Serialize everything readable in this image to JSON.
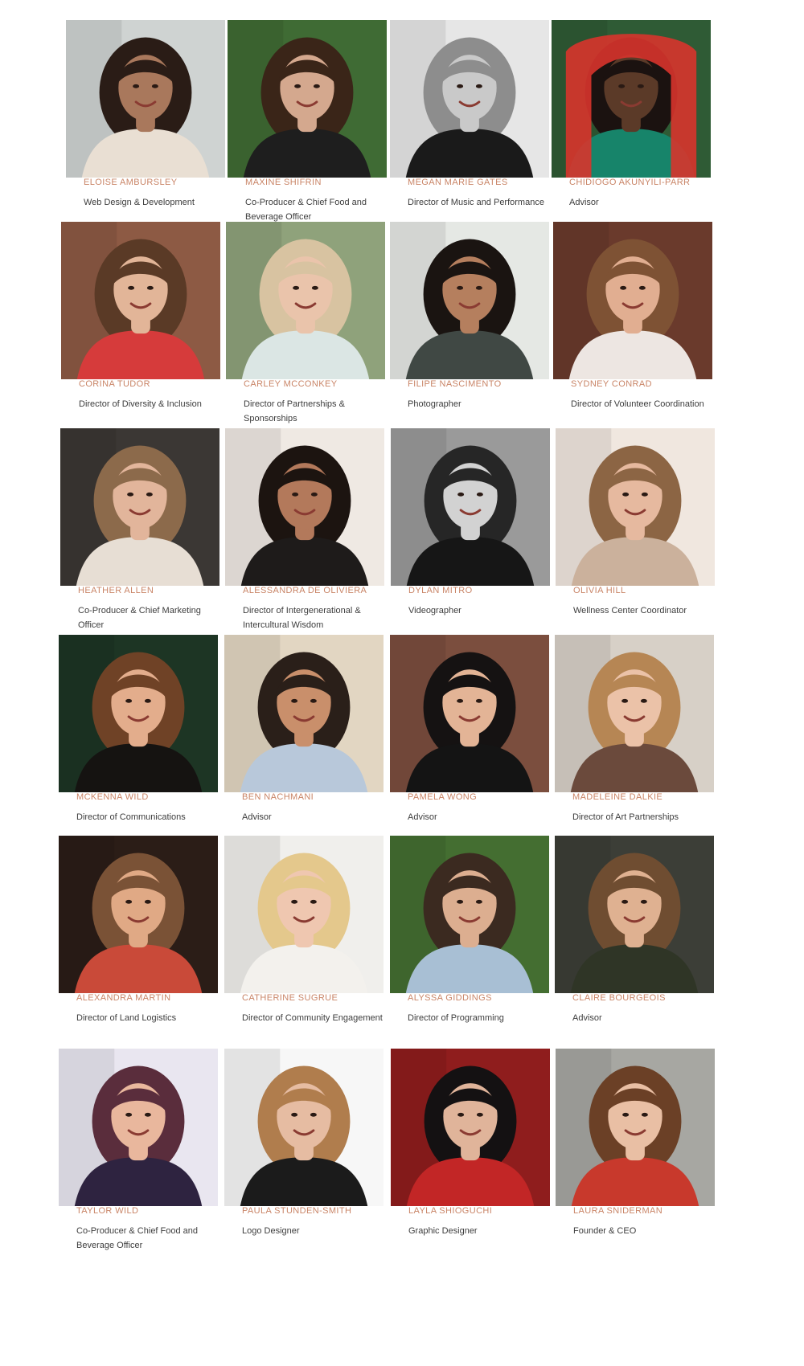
{
  "team": {
    "members": [
      {
        "name": "ELOISE AMBURSLEY",
        "role": "Web Design & Development",
        "photo": {
          "bg": "#cfd3d2",
          "skin": "#a9785c",
          "hair": "#2a1c16",
          "top": "#e9dfd3"
        }
      },
      {
        "name": "MAXINE SHIFRIN",
        "role": "Co-Producer & Chief Food and Beverage Officer",
        "photo": {
          "bg": "#3f6b34",
          "skin": "#d4a88e",
          "hair": "#3a2518",
          "top": "#1e1e1e"
        }
      },
      {
        "name": "MEGAN MARIE GATES",
        "role": "Director of Music and Performance",
        "photo": {
          "bg": "#e6e6e6",
          "skin": "#c9c9c9",
          "hair": "#8d8d8d",
          "top": "#1a1a1a"
        }
      },
      {
        "name": "CHIDIOGO AKUNYILI-PARR",
        "role": "Advisor",
        "photo": {
          "bg": "#2f5b35",
          "skin": "#5b3a28",
          "hair": "#1b1210",
          "top": "#17846a",
          "accent": "#d8342c"
        }
      },
      {
        "name": "CORINA TUDOR",
        "role": "Director of Diversity & Inclusion",
        "photo": {
          "bg": "#8d5a44",
          "skin": "#e2b598",
          "hair": "#5a3a26",
          "top": "#d63b3b"
        }
      },
      {
        "name": "CARLEY MCCONKEY",
        "role": "Director of Partnerships & Sponsorships",
        "photo": {
          "bg": "#8fa27b",
          "skin": "#eac4ab",
          "hair": "#d8c3a1",
          "top": "#dbe6e4"
        }
      },
      {
        "name": "FILIPE NASCIMENTO",
        "role": "Photographer",
        "photo": {
          "bg": "#e5e8e4",
          "skin": "#b57f5e",
          "hair": "#1a1411",
          "top": "#404844"
        }
      },
      {
        "name": "SYDNEY CONRAD",
        "role": "Director of Volunteer Coordination",
        "photo": {
          "bg": "#6a3a2c",
          "skin": "#e1ae91",
          "hair": "#7e5234",
          "top": "#ede6e2"
        }
      },
      {
        "name": "HEATHER ALLEN",
        "role": "Co-Producer & Chief Marketing Officer",
        "photo": {
          "bg": "#3b3734",
          "skin": "#e2b59b",
          "hair": "#8c6a4b",
          "top": "#e7ded4"
        }
      },
      {
        "name": "ALESSANDRA DE OLIVIERA",
        "role": "Director of Intergenerational & Intercultural Wisdom",
        "photo": {
          "bg": "#efe9e3",
          "skin": "#b3795b",
          "hair": "#1c1410",
          "top": "#1e1b1a"
        }
      },
      {
        "name": "DYLAN MITRO",
        "role": "Videographer",
        "photo": {
          "bg": "#9a9a9a",
          "skin": "#d2d2d2",
          "hair": "#262626",
          "top": "#161616"
        }
      },
      {
        "name": "OLIVIA HILL",
        "role": "Wellness Center Coordinator",
        "photo": {
          "bg": "#f0e7df",
          "skin": "#e6b99f",
          "hair": "#8c6544",
          "top": "#cbb19c"
        }
      },
      {
        "name": "MCKENNA WILD",
        "role": "Director of Communications",
        "photo": {
          "bg": "#1d3524",
          "skin": "#e3ad8c",
          "hair": "#6f4226",
          "top": "#151311"
        }
      },
      {
        "name": "BEN NACHMANI",
        "role": "Advisor",
        "photo": {
          "bg": "#e2d6c2",
          "skin": "#c98f6b",
          "hair": "#2a1f19",
          "top": "#b8c8da"
        }
      },
      {
        "name": "PAMELA WONG",
        "role": "Advisor",
        "photo": {
          "bg": "#7b4e3e",
          "skin": "#e3b496",
          "hair": "#151212",
          "top": "#141414"
        }
      },
      {
        "name": "MADELEINE DALKIE",
        "role": "Director of Art Partnerships",
        "photo": {
          "bg": "#d7d0c7",
          "skin": "#ebc2a8",
          "hair": "#b68654",
          "top": "#6b4a3c"
        }
      },
      {
        "name": "ALEXANDRA MARTIN",
        "role": "Director of Land Logistics",
        "photo": {
          "bg": "#2b1d17",
          "skin": "#e0a985",
          "hair": "#7a5236",
          "top": "#c94a39"
        }
      },
      {
        "name": "CATHERINE SUGRUE",
        "role": "Director of Community Engagement",
        "photo": {
          "bg": "#f0efec",
          "skin": "#efc7b0",
          "hair": "#e4c88c",
          "top": "#f3f1ed"
        }
      },
      {
        "name": "ALYSSA GIDDINGS",
        "role": "Director of Programming",
        "photo": {
          "bg": "#446e31",
          "skin": "#dcae90",
          "hair": "#3b2a20",
          "top": "#a8bfd4"
        }
      },
      {
        "name": "CLAIRE BOURGEOIS",
        "role": "Advisor",
        "photo": {
          "bg": "#3c3e37",
          "skin": "#dfb191",
          "hair": "#6f4d31",
          "top": "#2f3526"
        }
      },
      {
        "name": "TAYLOR WILD",
        "role": "Co-Producer & Chief Food and Beverage Officer",
        "photo": {
          "bg": "#e9e6f0",
          "skin": "#e9b79d",
          "hair": "#5a2d3c",
          "top": "#2e2340"
        }
      },
      {
        "name": "PAULA STUNDEN-SMITH",
        "role": "Logo Designer",
        "photo": {
          "bg": "#f7f7f7",
          "skin": "#e6bca2",
          "hair": "#b07d4d",
          "top": "#1b1b1b"
        }
      },
      {
        "name": "LAYLA SHIOGUCHI",
        "role": "Graphic Designer",
        "photo": {
          "bg": "#8f1d1d",
          "skin": "#e0b49a",
          "hair": "#141112",
          "top": "#c22626"
        }
      },
      {
        "name": "LAURA SNIDERMAN",
        "role": "Founder & CEO",
        "photo": {
          "bg": "#a7a7a2",
          "skin": "#e9bfa4",
          "hair": "#6b4026",
          "top": "#c8392c"
        }
      }
    ]
  }
}
